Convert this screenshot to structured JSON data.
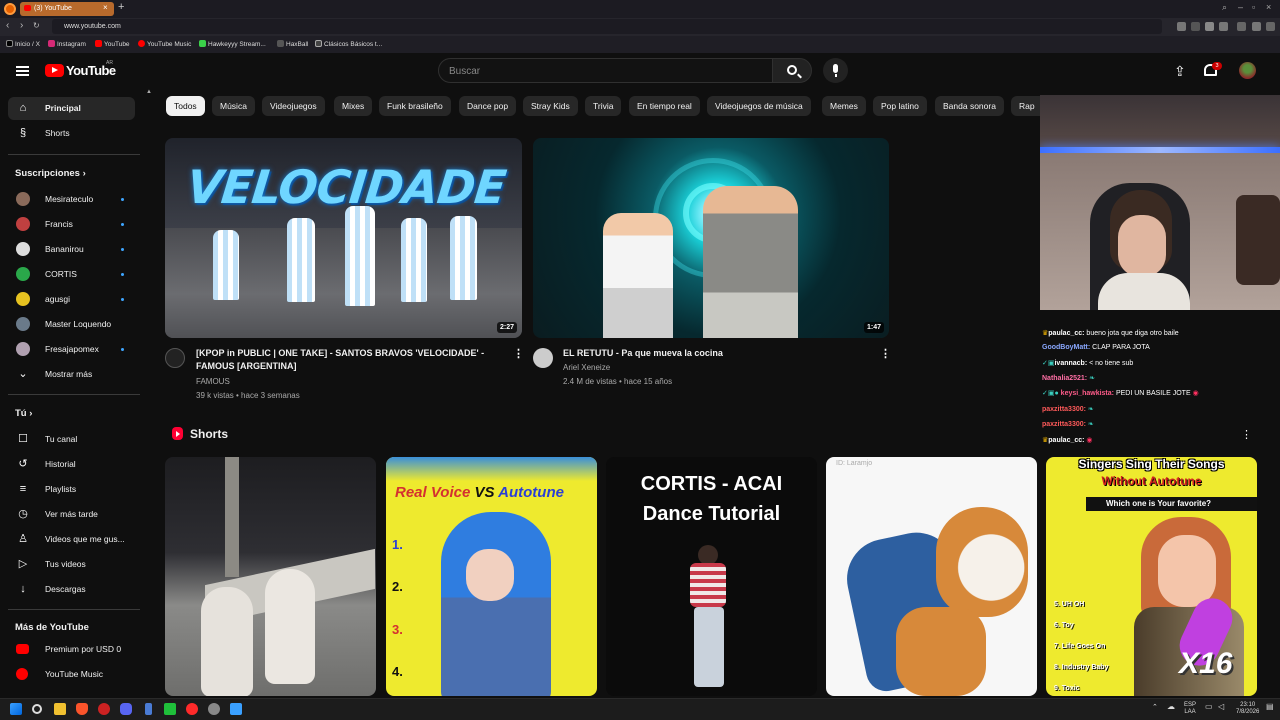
{
  "browser": {
    "tab_title": "(3) YouTube",
    "url": "www.youtube.com",
    "bookmarks": [
      "Inicio / X",
      "Instagram",
      "YouTube",
      "YouTube Music",
      "Hawkeyyy Stream...",
      "HaxBall",
      "Clásicos Básicos t..."
    ]
  },
  "header": {
    "logo_text": "YouTube",
    "country_code": "AR",
    "search_placeholder": "Buscar",
    "notification_count": "3"
  },
  "sidebar": {
    "main": [
      {
        "label": "Principal",
        "icon": "home-icon",
        "active": true
      },
      {
        "label": "Shorts",
        "icon": "shorts-icon"
      }
    ],
    "subscriptions_heading": "Suscripciones",
    "subscriptions": [
      {
        "label": "Mesirateculo",
        "color": "#8a6a5a"
      },
      {
        "label": "Francis",
        "color": "#c04040"
      },
      {
        "label": "Bananirou",
        "color": "#dddddd"
      },
      {
        "label": "CORTIS",
        "color": "#2aa84a"
      },
      {
        "label": "agusgi",
        "color": "#e6c220"
      },
      {
        "label": "Master Loquendo",
        "color": "#6a7a8a"
      },
      {
        "label": "Fresajapomex",
        "color": "#b0a0b0"
      }
    ],
    "show_more": "Mostrar más",
    "you_heading": "Tú",
    "you_items": [
      {
        "label": "Tu canal",
        "icon": "user-icon"
      },
      {
        "label": "Historial",
        "icon": "history-icon"
      },
      {
        "label": "Playlists",
        "icon": "playlists-icon"
      },
      {
        "label": "Ver más tarde",
        "icon": "clock-icon"
      },
      {
        "label": "Videos que me gus...",
        "icon": "thumbs-up-icon"
      },
      {
        "label": "Tus videos",
        "icon": "video-icon"
      },
      {
        "label": "Descargas",
        "icon": "download-icon"
      }
    ],
    "more_heading": "Más de YouTube",
    "more_items": [
      {
        "label": "Premium por USD 0",
        "icon": "youtube-premium-icon"
      },
      {
        "label": "YouTube Music",
        "icon": "youtube-music-icon"
      }
    ]
  },
  "chips": [
    "Todos",
    "Música",
    "Videojuegos",
    "Mixes",
    "Funk brasileño",
    "Dance pop",
    "Stray Kids",
    "Trivia",
    "En tiempo real",
    "Videojuegos de música",
    "Memes",
    "Pop latino",
    "Banda sonora",
    "Rap"
  ],
  "videos": [
    {
      "thumb_text": "VELOCIDADE",
      "duration": "2:27",
      "title": "[KPOP in PUBLIC | ONE TAKE] - SANTOS BRAVOS 'VELOCIDADE' - FAMOUS [ARGENTINA]",
      "channel": "FAMOUS",
      "meta": "39 k vistas • hace 3 semanas"
    },
    {
      "duration": "1:47",
      "title": "EL RETUTU - Pa que mueva la cocina",
      "channel": "Ariel Xeneize",
      "meta": "2.4 M de vistas • hace 15 años"
    }
  ],
  "shorts_heading": "Shorts",
  "shorts": [
    {
      "overlay": ""
    },
    {
      "overlay_a": "Real Voice",
      "overlay_vs": "VS",
      "overlay_b": "Autotune",
      "numbers": [
        "1.",
        "2.",
        "3.",
        "4."
      ]
    },
    {
      "overlay_line1": "CORTIS - ACAI",
      "overlay_line2": "Dance Tutorial"
    },
    {
      "overlay": "ID: Laramjo"
    },
    {
      "overlay_line1": "Singers Sing Their Songs",
      "overlay_line2": "Without Autotune",
      "overlay_line3": "Which one is Your favorite?",
      "list": [
        "5. UH OH",
        "6. Toy",
        "7. Life Goes On",
        "8. Industry Baby",
        "9. Toxic"
      ],
      "badge": "X16"
    }
  ],
  "chat": [
    {
      "user": "paulac_cc:",
      "text": "bueno jota que diga otro baile",
      "color": "#ffffff"
    },
    {
      "user": "GoodBoyMatt:",
      "text": "CLAP PARA JOTA",
      "color": "#8aa8ff"
    },
    {
      "user": "ivannacb:",
      "text": "< no tiene sub",
      "color": "#ffffff"
    },
    {
      "user": "Nathalia2521:",
      "text": "",
      "color": "#ff6fa5"
    },
    {
      "user": "keysi_hawkista:",
      "text": "PEDI UN BASILE JOTE",
      "color": "#ff5c8a"
    },
    {
      "user": "paxzitta3300:",
      "text": "",
      "color": "#ff5a5a"
    },
    {
      "user": "paxzitta3300:",
      "text": "",
      "color": "#ff5a5a"
    },
    {
      "user": "paulac_cc:",
      "text": "",
      "color": "#ffffff"
    }
  ],
  "taskbar": {
    "lang": "ESP",
    "lang2": "LAA",
    "time": "23:10",
    "date": "7/8/2026"
  }
}
